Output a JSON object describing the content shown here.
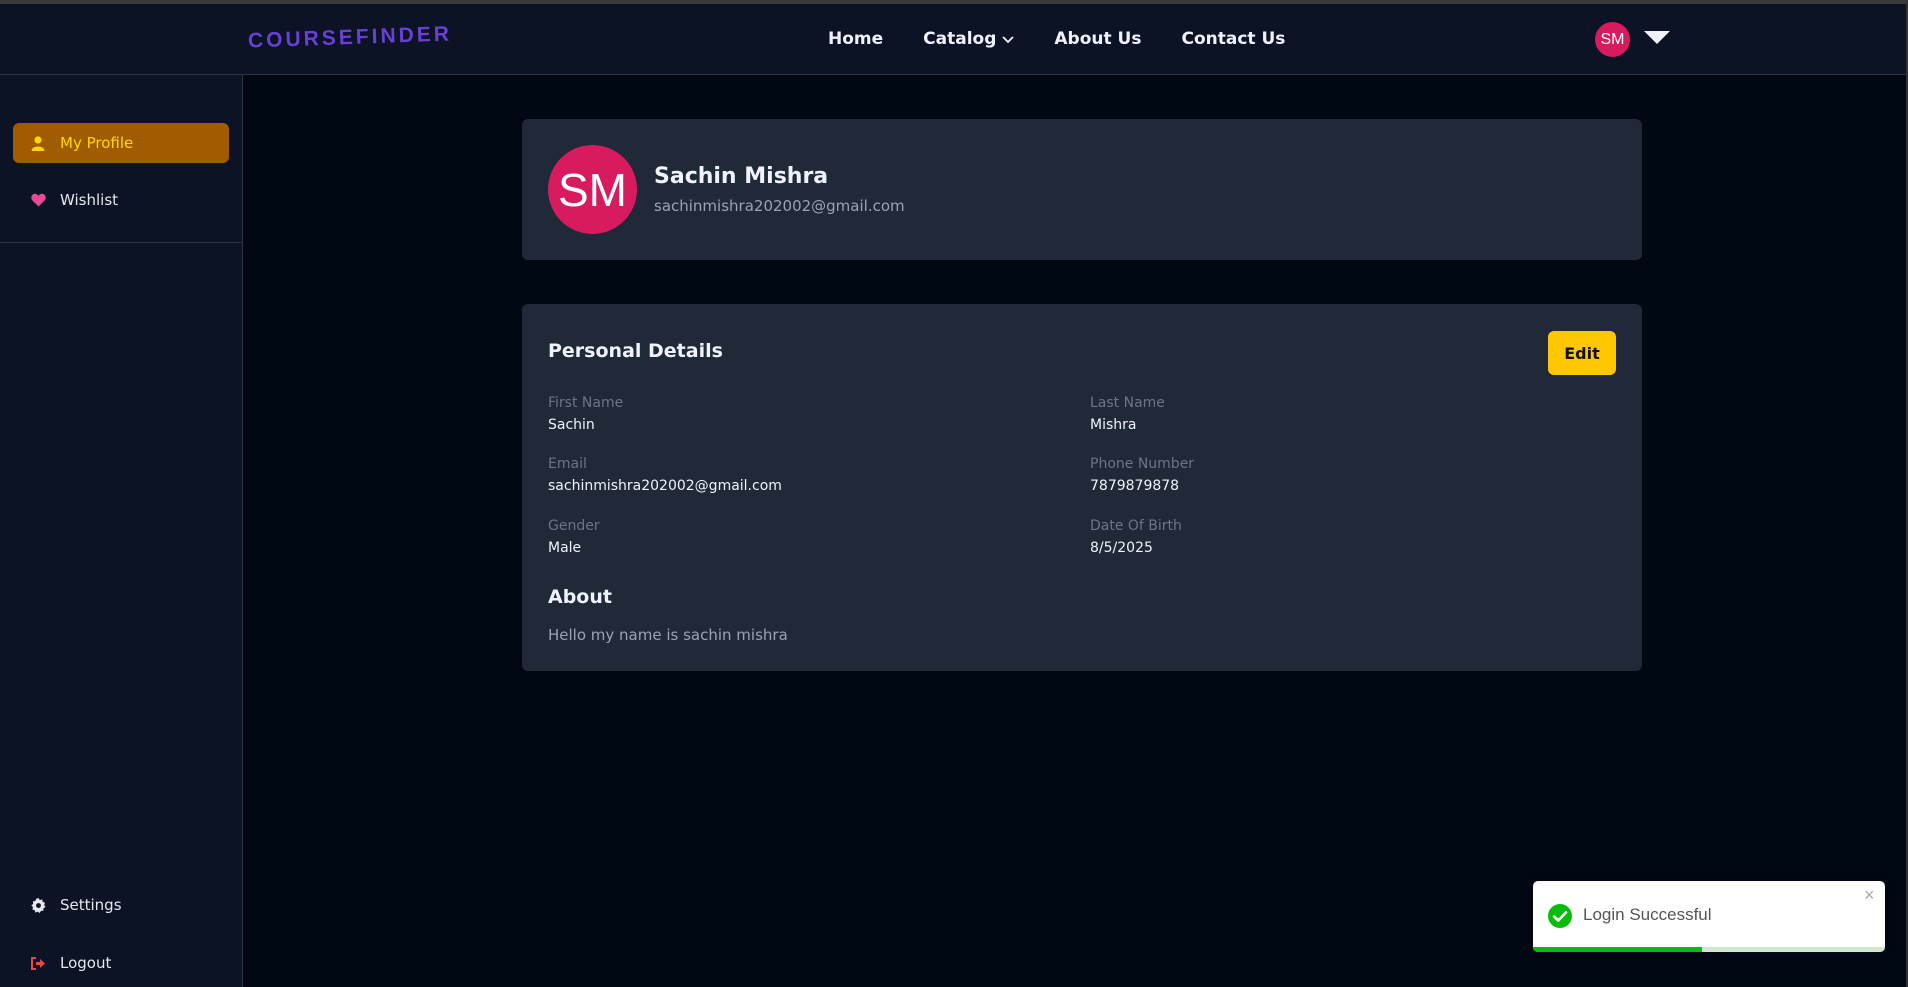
{
  "brand": {
    "logo": "COURSEFINDER"
  },
  "nav": {
    "home": "Home",
    "catalog": "Catalog",
    "about": "About Us",
    "contact": "Contact Us"
  },
  "user": {
    "initials": "SM"
  },
  "sidebar": {
    "items": [
      {
        "label": "My Profile",
        "icon": "user-icon",
        "active": true
      },
      {
        "label": "Wishlist",
        "icon": "heart-icon",
        "active": false
      }
    ],
    "bottom": [
      {
        "label": "Settings",
        "icon": "gear-icon"
      },
      {
        "label": "Logout",
        "icon": "logout-icon"
      }
    ]
  },
  "profile": {
    "initials": "SM",
    "name": "Sachin Mishra",
    "email": "sachinmishra202002@gmail.com"
  },
  "details": {
    "title": "Personal Details",
    "edit_label": "Edit",
    "fields": [
      {
        "label": "First Name",
        "value": "Sachin"
      },
      {
        "label": "Last Name",
        "value": "Mishra"
      },
      {
        "label": "Email",
        "value": "sachinmishra202002@gmail.com"
      },
      {
        "label": "Phone Number",
        "value": "7879879878"
      },
      {
        "label": "Gender",
        "value": "Male"
      },
      {
        "label": "Date Of Birth",
        "value": "8/5/2025"
      }
    ],
    "about_title": "About",
    "about_text": "Hello my name is sachin mishra"
  },
  "toast": {
    "message": "Login Successful",
    "close": "×",
    "progress": 0.48
  },
  "colors": {
    "accent": "#ffc700",
    "active_bg": "#a15c00",
    "avatar": "#d81b5f",
    "success": "#07bc0c"
  }
}
